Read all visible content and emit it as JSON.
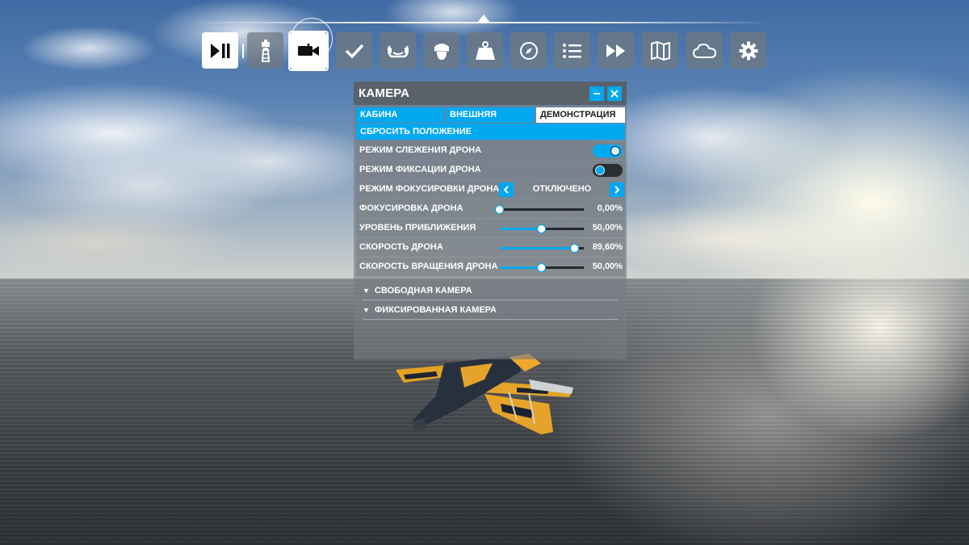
{
  "toolbar": {
    "buttons": [
      {
        "name": "pause-resume-button",
        "icon": "play-pause-icon"
      },
      {
        "name": "atc-button",
        "icon": "control-tower-icon"
      },
      {
        "name": "camera-button",
        "icon": "camera-icon",
        "active": true
      },
      {
        "name": "checklist-button",
        "icon": "checkmark-icon"
      },
      {
        "name": "headset-button",
        "icon": "headset-icon"
      },
      {
        "name": "pilot-button",
        "icon": "pilot-cap-icon"
      },
      {
        "name": "weight-button",
        "icon": "weight-icon"
      },
      {
        "name": "navlog-button",
        "icon": "compass-icon"
      },
      {
        "name": "objectives-button",
        "icon": "list-icon"
      },
      {
        "name": "sim-rate-button",
        "icon": "fast-forward-icon"
      },
      {
        "name": "vfr-map-button",
        "icon": "map-icon"
      },
      {
        "name": "weather-button",
        "icon": "cloud-icon"
      },
      {
        "name": "settings-button",
        "icon": "gear-icon"
      }
    ]
  },
  "panel": {
    "title": "КАМЕРА",
    "tabs": [
      "КАБИНА",
      "ВНЕШНЯЯ",
      "ДЕМОНСТРАЦИЯ"
    ],
    "active_tab": "ДЕМОНСТРАЦИЯ",
    "reset_label": "СБРОСИТЬ ПОЛОЖЕНИЕ",
    "toggles": [
      {
        "label": "РЕЖИМ СЛЕЖЕНИЯ ДРОНА",
        "on": true
      },
      {
        "label": "РЕЖИМ ФИКСАЦИИ ДРОНА",
        "on": false
      }
    ],
    "focus_mode": {
      "label": "РЕЖИМ ФОКУСИРОВКИ ДРОНА",
      "value": "ОТКЛЮЧЕНО"
    },
    "sliders": [
      {
        "label": "ФОКУСИРОВКА ДРОНА",
        "value_text": "0,00%",
        "value": 0.0
      },
      {
        "label": "УРОВЕНЬ ПРИБЛИЖЕНИЯ",
        "value_text": "50,00%",
        "value": 50.0
      },
      {
        "label": "СКОРОСТЬ ДРОНА",
        "value_text": "89,60%",
        "value": 89.6
      },
      {
        "label": "СКОРОСТЬ ВРАЩЕНИЯ ДРОНА",
        "value_text": "50,00%",
        "value": 50.0
      }
    ],
    "sections": [
      "СВОБОДНАЯ КАМЕРА",
      "ФИКСИРОВАННАЯ КАМЕРА"
    ]
  },
  "colors": {
    "accent": "#00a8f0",
    "panel_bg": "#767c82"
  }
}
